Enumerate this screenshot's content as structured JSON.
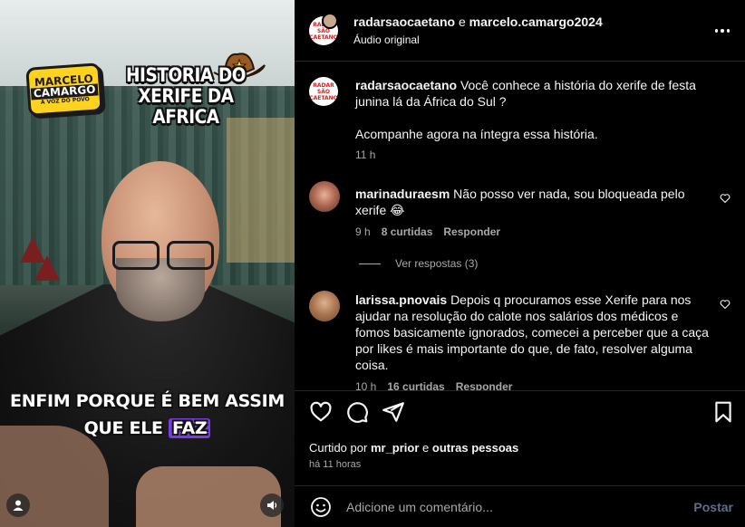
{
  "video": {
    "title_line1": "HISTORIA DO",
    "title_line2": "XERIFE DA AFRICA",
    "logo_line1": "MARCELO",
    "logo_line2": "CAMARGO",
    "logo_line3": "A VOZ DO POVO",
    "caption_line1": "ENFIM PORQUE É BEM ASSIM",
    "caption_line2_a": "QUE ELE ",
    "caption_line2_b": "FAZ",
    "caption_highlight_color": "#7a3ce0"
  },
  "header": {
    "user1": "radarsaocaetano",
    "connector": "e",
    "user2": "marcelo.camargo2024",
    "audio": "Áudio original",
    "avatar_text1": "RADAR",
    "avatar_text2": "SÃO CAETANO"
  },
  "caption_post": {
    "username": "radarsaocaetano",
    "text1": "Você conhece a história do xerife de festa junina lá da África do Sul ?",
    "text2": "Acompanhe agora na íntegra essa história.",
    "time": "11 h"
  },
  "comments": [
    {
      "username": "marinaduraesm",
      "text": "Não posso ver nada, sou bloqueada pelo xerife 😂",
      "time": "9 h",
      "likes": "8 curtidas",
      "reply": "Responder",
      "view_replies": "Ver respostas (3)"
    },
    {
      "username": "larissa.pnovais",
      "text": "Depois q procuramos esse Xerife para nos ajudar na resolução do calote nos salários dos médicos e fomos basicamente ignorados, comecei a perceber que a caça por likes é mais importante do que, de fato, resolver alguma coisa.",
      "time": "10 h",
      "likes": "16 curtidas",
      "reply": "Responder"
    }
  ],
  "actions": {
    "liked_prefix": "Curtido por",
    "liked_user": "mr_prior",
    "liked_connector": "e",
    "liked_others": "outras pessoas",
    "time_ago": "há 11 horas"
  },
  "add_comment": {
    "placeholder": "Adicione um comentário...",
    "post": "Postar"
  },
  "colors": {
    "background": "#000000",
    "text": "#f5f5f5",
    "muted": "#a8a8a8",
    "post_disabled": "#5f6f86"
  }
}
